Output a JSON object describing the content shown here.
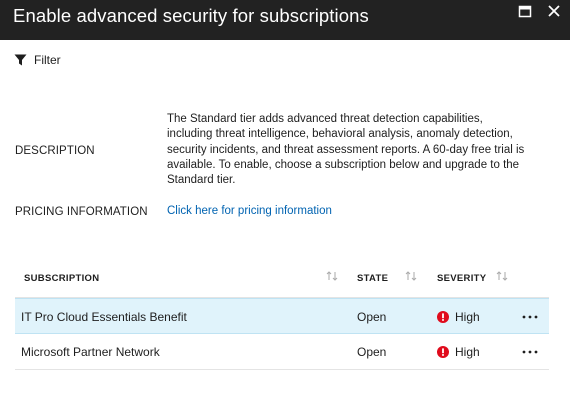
{
  "window": {
    "title": "Enable advanced security for subscriptions",
    "maximize_icon": "maximize-icon",
    "close_icon": "close-icon"
  },
  "toolbar": {
    "filter_label": "Filter",
    "filter_icon": "filter-icon"
  },
  "details": {
    "description_label": "DESCRIPTION",
    "description_text": "The Standard tier adds advanced threat detection capabilities, including threat intelligence, behavioral analysis, anomaly detection, security incidents, and threat assessment reports. A 60-day free trial is available. To enable, choose a subscription below and upgrade to the Standard tier.",
    "pricing_label": "PRICING INFORMATION",
    "pricing_link": "Click here for pricing information"
  },
  "table": {
    "columns": [
      "SUBSCRIPTION",
      "STATE",
      "SEVERITY"
    ],
    "rows": [
      {
        "subscription": "IT Pro Cloud Essentials Benefit",
        "state": "Open",
        "severity": "High",
        "selected": true
      },
      {
        "subscription": "Microsoft Partner Network",
        "state": "Open",
        "severity": "High",
        "selected": false
      }
    ]
  },
  "colors": {
    "titlebar_bg": "#222222",
    "link": "#0063b1",
    "selected_row": "#e0f3fb",
    "severity_high": "#e00b1c"
  }
}
